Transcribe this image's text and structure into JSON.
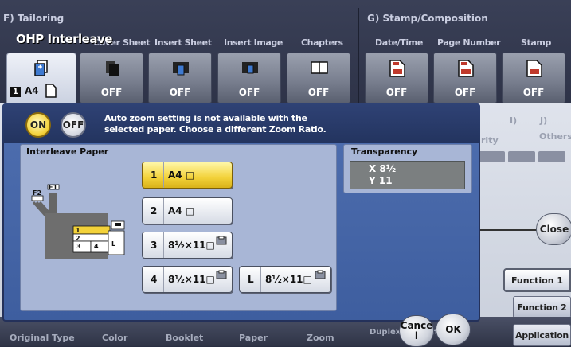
{
  "header": {
    "section_f": "F)  Tailoring",
    "section_g": "G)  Stamp/Composition",
    "columns_f": [
      "Cover Sheet",
      "Insert Sheet",
      "Insert Image",
      "Chapters"
    ],
    "columns_g": [
      "Date/Time",
      "Page Number",
      "Stamp"
    ],
    "active_title": "OHP Interleave",
    "active_tile": {
      "page_badge": "1",
      "paper": "A4"
    },
    "tile_values": [
      "OFF",
      "OFF",
      "OFF",
      "OFF",
      "OFF",
      "OFF",
      "OFF"
    ]
  },
  "right_panel": {
    "labels": [
      "I)",
      "J)",
      "Others",
      "rity"
    ],
    "close_label": "Close",
    "function1": "Function 1",
    "function2": "Function 2",
    "application": "Application"
  },
  "bottom_bar": {
    "labels": [
      "Original Type",
      "Color",
      "Booklet",
      "Paper",
      "Zoom",
      "Duplex/Combine"
    ]
  },
  "dialog": {
    "on_label": "ON",
    "off_label": "OFF",
    "message": "Auto zoom setting is not available with the selected paper. Choose a different Zoom Ratio.",
    "interleave_title": "Interleave Paper",
    "paper_options": [
      {
        "num": "1",
        "text": "A4 □",
        "selected": true
      },
      {
        "num": "2",
        "text": "A4 □",
        "selected": false
      },
      {
        "num": "3",
        "text": "8½×11□",
        "selected": false
      },
      {
        "num": "4",
        "text": "8½×11□",
        "selected": false
      },
      {
        "num": "L",
        "text": "8½×11□",
        "selected": false
      }
    ],
    "diagram_labels": {
      "f1": "F1",
      "f2": "F2",
      "t1": "1",
      "t2": "2",
      "t3": "3",
      "t4": "4",
      "tl": "L"
    },
    "transparency_title": "Transparency",
    "transparency_x": "X  8½",
    "transparency_y": "Y  11",
    "cancel_label": "Cance\nl",
    "ok_label": "OK"
  },
  "colors": {
    "dialog_blue": "#4f6fb0",
    "selected_yellow": "#f3d23a"
  }
}
